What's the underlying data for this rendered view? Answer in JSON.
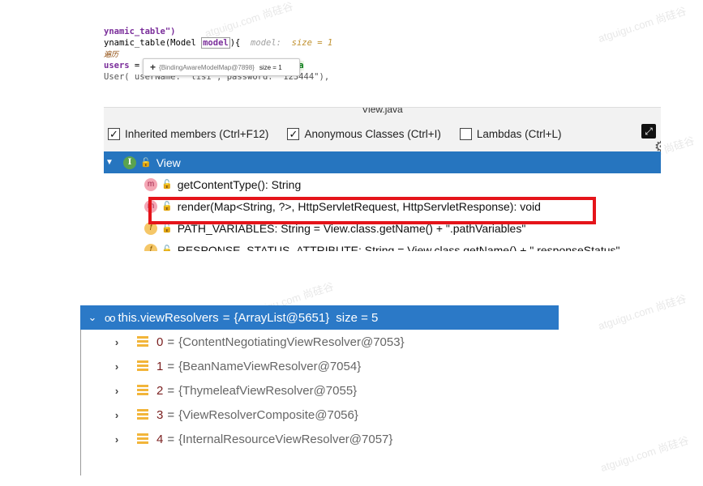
{
  "watermarks": [
    "atguigu.com 尚硅谷",
    "atguigu.com 尚硅谷",
    "atguigu.com 尚硅谷",
    "atguigu.com 尚硅谷",
    "atguigu.com 尚硅谷",
    "atguigu.com 尚硅谷"
  ],
  "code": {
    "line1": "ynamic_table\")",
    "line2_pre": "ynamic_table(Model ",
    "line2_param": "model",
    "line2_post": "){",
    "line2_hint": "model:",
    "line2_hint_val": "size = 1",
    "line3": "遍历",
    "line4_var": "users",
    "line4_eq": " =",
    "line4_str": "\"zha",
    "line5": "User( userName: \"lisi\", password: \"123444\"),"
  },
  "tooltip": {
    "text": "{BindingAwareModelMap@7898}",
    "size": "size = 1"
  },
  "structure": {
    "title": "View.java",
    "options": [
      {
        "label": "Inherited members (Ctrl+F12)",
        "checked": true
      },
      {
        "label": "Anonymous Classes (Ctrl+I)",
        "checked": true
      },
      {
        "label": "Lambdas (Ctrl+L)",
        "checked": false
      }
    ],
    "root": {
      "icon": "I",
      "label": "View"
    },
    "members": [
      {
        "icon": "m",
        "label": "getContentType(): String"
      },
      {
        "icon": "m",
        "label": "render(Map<String, ?>, HttpServletRequest, HttpServletResponse): void"
      },
      {
        "icon": "f",
        "label": "PATH_VARIABLES: String = View.class.getName() + \".pathVariables\""
      },
      {
        "icon": "f",
        "label": "RESPONSE_STATUS_ATTRIBUTE: String = View.class.getName() + \".responseStatus\""
      }
    ]
  },
  "debugger": {
    "root": {
      "name": "this.viewResolvers",
      "value": "{ArrayList@5651}",
      "size": "size = 5"
    },
    "items": [
      {
        "index": "0",
        "value": "{ContentNegotiatingViewResolver@7053}"
      },
      {
        "index": "1",
        "value": "{BeanNameViewResolver@7054}"
      },
      {
        "index": "2",
        "value": "{ThymeleafViewResolver@7055}"
      },
      {
        "index": "3",
        "value": "{ViewResolverComposite@7056}"
      },
      {
        "index": "4",
        "value": "{InternalResourceViewResolver@7057}"
      }
    ]
  }
}
